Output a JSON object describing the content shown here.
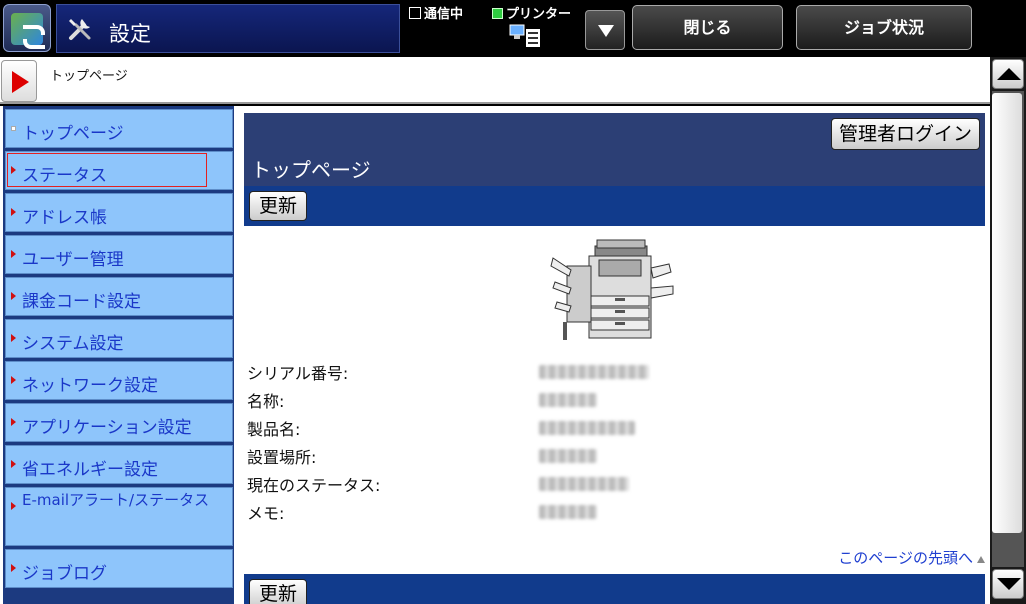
{
  "topbar": {
    "title": "設定",
    "comm_status": "通信中",
    "printer_status": "プリンター",
    "close_label": "閉じる",
    "job_status_label": "ジョブ状況"
  },
  "addressbar": {
    "breadcrumb": "トップページ"
  },
  "sidebar": {
    "items": [
      {
        "label": "トップページ",
        "icon": "square-bullet"
      },
      {
        "label": "ステータス",
        "icon": "triangle-bullet",
        "selected": true
      },
      {
        "label": "アドレス帳",
        "icon": "triangle-bullet"
      },
      {
        "label": "ユーザー管理",
        "icon": "triangle-bullet"
      },
      {
        "label": "課金コード設定",
        "icon": "triangle-bullet"
      },
      {
        "label": "システム設定",
        "icon": "triangle-bullet"
      },
      {
        "label": "ネットワーク設定",
        "icon": "triangle-bullet"
      },
      {
        "label": "アプリケーション設定",
        "icon": "triangle-bullet"
      },
      {
        "label": "省エネルギー設定",
        "icon": "triangle-bullet"
      },
      {
        "label": "E-mailアラート/ステータス",
        "icon": "triangle-bullet"
      },
      {
        "label": "ジョブログ",
        "icon": "triangle-bullet"
      }
    ]
  },
  "main": {
    "admin_login_label": "管理者ログイン",
    "page_title": "トップページ",
    "refresh_label": "更新",
    "info_rows": [
      {
        "label": "シリアル番号:"
      },
      {
        "label": "名称:"
      },
      {
        "label": "製品名:"
      },
      {
        "label": "設置場所:"
      },
      {
        "label": "現在のステータス:"
      },
      {
        "label": "メモ:"
      }
    ],
    "page_top_link": "このページの先頭へ"
  },
  "colors": {
    "sidebar_item_bg": "#8ec5fb",
    "sidebar_link": "#1a37c8",
    "header_bg": "#2c3f75",
    "refresh_bar_bg": "#113b8c",
    "selection_outline": "#e32020"
  }
}
